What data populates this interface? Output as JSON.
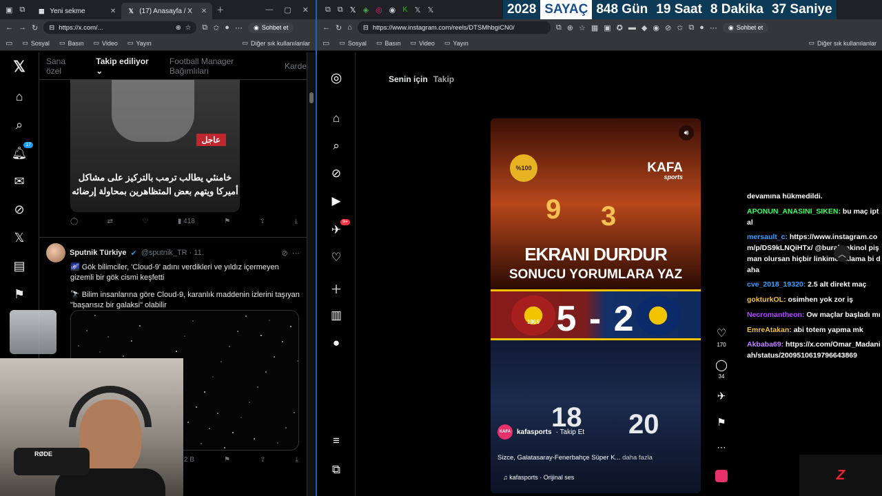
{
  "left": {
    "tabs": [
      {
        "label": "Yeni sekme"
      },
      {
        "label": "(17) Anasayfa / X"
      }
    ],
    "url": "https://x.com/...",
    "chat_label": "Sohbet et",
    "bookmarks": [
      "Sosyal",
      "Basın",
      "Video",
      "Yayın"
    ],
    "bookmarks_right": "Diğer sık kullanılanlar",
    "notification_count": "17",
    "feed_tabs": [
      "Sana özel",
      "Takip ediliyor",
      "Football Manager Bağımlıları",
      "Karde"
    ],
    "tweet1": {
      "tag": "عاجل",
      "caption": "خامنئي يطالب ترمب بالتركيز على مشاكل أميركا ويتهم بعض المتظاهرين بمحاولة إرضائه",
      "views": "418"
    },
    "tweet2": {
      "name": "Sputnik Türkiye",
      "handle": "@sputnik_TR · 11.",
      "line1": "🌌 Gök bilimciler, 'Cloud-9' adını verdikleri ve yıldız içermeyen gizemli bir gök cismi keşfetti",
      "line2": "🔭 Bilim insanlarına göre Cloud-9, karanlık maddenin izlerini taşıyan \"başarısız bir galaksi\" olabilir",
      "views": "2 B"
    },
    "mic_label": "RØDE"
  },
  "right": {
    "counter": {
      "year": "2028",
      "label": "SAYAÇ",
      "days": "848",
      "days_label": "Gün",
      "hours": "19",
      "hours_label": "Saat",
      "minutes": "8",
      "minutes_label": "Dakika",
      "seconds": "37",
      "seconds_label": "Saniye"
    },
    "url": "https://www.instagram.com/reels/DTSMhbgiCN0/",
    "chat_label": "Sohbet et",
    "bookmarks": [
      "Sosyal",
      "Basın",
      "Video",
      "Yayın"
    ],
    "bookmarks_right": "Diğer sık kullanılanlar",
    "ig_tabs": {
      "for_you": "Senin için",
      "following": "Takip"
    },
    "notif_badge": "9+",
    "reel": {
      "logo100": "%100",
      "brand": "KAFA",
      "brand_sub": "sports",
      "title": "EKRANI DURDUR",
      "subtitle": "SONUCU YORUMLARA YAZ",
      "score": "5 - 2",
      "gs_year": "1905",
      "author": "kafasports",
      "follow": "· Takip Et",
      "caption": "Sizce, Galatasaray-Fenerbahçe Süper K...",
      "more": "daha fazla",
      "audio": "♫ kafasports · Orijinal ses",
      "avatar_text": "KAFA"
    },
    "likes": "170",
    "comments": "34",
    "chat": [
      {
        "user": "",
        "text": "devamına hükmedildi.",
        "color": "#ffffff"
      },
      {
        "user": "APONUN_ANASINI_SIKEN:",
        "text": "bu maç iptal",
        "color": "#33ff66"
      },
      {
        "user": "mersault_c:",
        "text": "https://www.instagram.com/p/DS9kLNQiHTx/ @buraksakinol pişman olursan hiçbir linkime tıklama bi daha",
        "color": "#3aa0ff"
      },
      {
        "user": "cve_2018_19320:",
        "text": "2.5 alt direkt maç",
        "color": "#3aa0ff"
      },
      {
        "user": "gokturkOL:",
        "text": "osimhen yok zor iş",
        "color": "#f0c040"
      },
      {
        "user": "Necromantheon:",
        "text": "Ow maçlar başladı mı",
        "color": "#b04cff"
      },
      {
        "user": "EmreAtakan:",
        "text": "abi totem yapma mk",
        "color": "#f0c040"
      },
      {
        "user": "Akbaba69:",
        "text": "https://x.com/Omar_Madaniah/status/2009510619796643869",
        "color": "#c080ff"
      }
    ],
    "stream_logo": "Z"
  }
}
